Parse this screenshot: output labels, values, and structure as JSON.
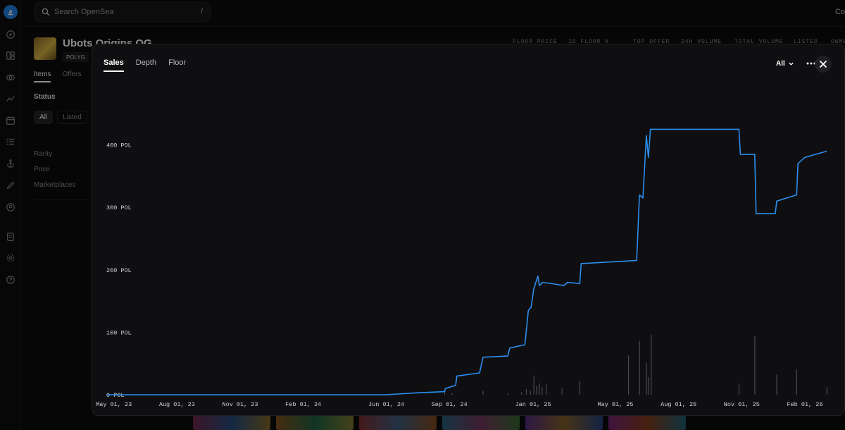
{
  "search": {
    "placeholder": "Search OpenSea",
    "shortcut": "/"
  },
  "topbar": {
    "right_cut_text": "Co"
  },
  "rail_icons": [
    "opensea-logo",
    "compass-icon",
    "grid-icon",
    "swap-icon",
    "chart-icon",
    "calendar-icon",
    "list-icon",
    "anchor-icon",
    "pencil-icon",
    "profile-icon",
    "library-icon",
    "settings-icon",
    "help-icon"
  ],
  "collection": {
    "title": "Ubots Origins OG",
    "chain": "POLYG",
    "stats_headers": [
      "FLOOR PRICE",
      "1D FLOOR %",
      "TOP OFFER",
      "24H VOLUME",
      "TOTAL VOLUME",
      "LISTED",
      "OWNE"
    ],
    "tabs": [
      "Items",
      "Offers"
    ],
    "status_label": "Status",
    "status_chips": [
      "All",
      "Listed"
    ],
    "filters": [
      "Rarity",
      "Price",
      "Marketplaces"
    ]
  },
  "modal": {
    "tabs": [
      "Sales",
      "Depth",
      "Floor"
    ],
    "active_tab": "Sales",
    "range_label": "All",
    "accent_color": "#2b8ef0"
  },
  "chart_data": {
    "type": "line",
    "title": "",
    "xlabel": "",
    "ylabel": "",
    "y_unit": "POL",
    "ylim": [
      0,
      500
    ],
    "xlim": [
      "2023-04-20",
      "2026-03-10"
    ],
    "y_ticks": [
      "0 POL",
      "100 POL",
      "200 POL",
      "300 POL",
      "400 POL"
    ],
    "y_tick_values": [
      0,
      100,
      200,
      300,
      400
    ],
    "x_ticks": [
      "May 01, 23",
      "Aug 01, 23",
      "Nov 01, 23",
      "Feb 01, 24",
      "Jun 01, 24",
      "Sep 01, 24",
      "Jan 01, 25",
      "May 01, 25",
      "Aug 01, 25",
      "Nov 01, 25",
      "Feb 01, 26"
    ],
    "x_tick_dates": [
      "2023-05-01",
      "2023-08-01",
      "2023-11-01",
      "2024-02-01",
      "2024-06-01",
      "2024-09-01",
      "2025-01-01",
      "2025-05-01",
      "2025-08-01",
      "2025-11-01",
      "2026-02-01"
    ],
    "grid": false,
    "series": [
      {
        "points": [
          [
            "2023-04-20",
            0
          ],
          [
            "2024-06-01",
            0
          ],
          [
            "2024-07-15",
            3
          ],
          [
            "2024-08-25",
            5
          ],
          [
            "2024-08-26",
            10
          ],
          [
            "2024-09-10",
            15
          ],
          [
            "2024-09-12",
            30
          ],
          [
            "2024-10-15",
            35
          ],
          [
            "2024-10-20",
            60
          ],
          [
            "2024-11-25",
            62
          ],
          [
            "2024-11-28",
            75
          ],
          [
            "2024-12-20",
            80
          ],
          [
            "2024-12-25",
            135
          ],
          [
            "2024-12-29",
            140
          ],
          [
            "2025-01-02",
            170
          ],
          [
            "2025-01-08",
            190
          ],
          [
            "2025-01-10",
            175
          ],
          [
            "2025-01-15",
            180
          ],
          [
            "2025-02-15",
            175
          ],
          [
            "2025-02-20",
            180
          ],
          [
            "2025-03-10",
            178
          ],
          [
            "2025-03-12",
            210
          ],
          [
            "2025-06-01",
            215
          ],
          [
            "2025-06-05",
            320
          ],
          [
            "2025-06-10",
            315
          ],
          [
            "2025-06-15",
            415
          ],
          [
            "2025-06-18",
            380
          ],
          [
            "2025-06-21",
            425
          ],
          [
            "2025-10-28",
            425
          ],
          [
            "2025-10-30",
            385
          ],
          [
            "2025-11-20",
            385
          ],
          [
            "2025-11-22",
            290
          ],
          [
            "2025-12-20",
            290
          ],
          [
            "2025-12-22",
            310
          ],
          [
            "2026-01-20",
            320
          ],
          [
            "2026-01-22",
            370
          ],
          [
            "2026-02-01",
            380
          ],
          [
            "2026-03-05",
            390
          ]
        ]
      }
    ],
    "volume_bars": [
      [
        "2024-08-25",
        4
      ],
      [
        "2024-09-05",
        3
      ],
      [
        "2024-10-20",
        6
      ],
      [
        "2024-11-25",
        3
      ],
      [
        "2024-12-15",
        4
      ],
      [
        "2024-12-22",
        9
      ],
      [
        "2024-12-28",
        6
      ],
      [
        "2025-01-02",
        30
      ],
      [
        "2025-01-06",
        14
      ],
      [
        "2025-01-10",
        18
      ],
      [
        "2025-01-14",
        12
      ],
      [
        "2025-01-20",
        16
      ],
      [
        "2025-02-12",
        10
      ],
      [
        "2025-03-10",
        22
      ],
      [
        "2025-05-20",
        62
      ],
      [
        "2025-06-05",
        85
      ],
      [
        "2025-06-15",
        50
      ],
      [
        "2025-06-18",
        28
      ],
      [
        "2025-06-22",
        95
      ],
      [
        "2025-10-28",
        18
      ],
      [
        "2025-11-20",
        92
      ],
      [
        "2025-12-22",
        32
      ],
      [
        "2026-01-20",
        40
      ],
      [
        "2026-03-05",
        12
      ]
    ]
  }
}
